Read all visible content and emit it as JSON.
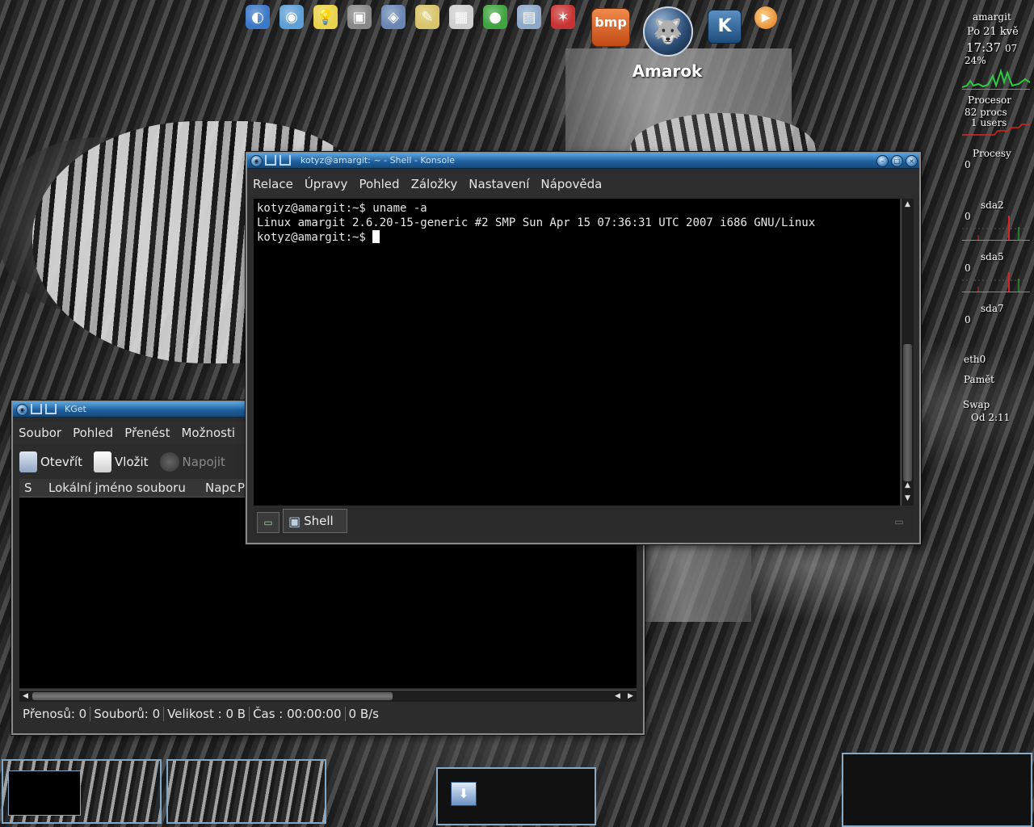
{
  "dock": {
    "launchers": [
      {
        "name": "browser-icon",
        "glyph": "◐",
        "color": "#3a78c8"
      },
      {
        "name": "globe-icon",
        "glyph": "◉",
        "color": "#5d9fd6"
      },
      {
        "name": "lightbulb-icon",
        "glyph": "💡",
        "color": "#e9d34a"
      },
      {
        "name": "monitor-icon",
        "glyph": "▣",
        "color": "#888888"
      },
      {
        "name": "save-disk-icon",
        "glyph": "◈",
        "color": "#6a86b4"
      },
      {
        "name": "notepad-icon",
        "glyph": "✎",
        "color": "#d9c46a"
      },
      {
        "name": "spreadsheet-icon",
        "glyph": "▦",
        "color": "#cfcfcf"
      },
      {
        "name": "network-globe-icon",
        "glyph": "●",
        "color": "#3fa53f"
      },
      {
        "name": "photos-icon",
        "glyph": "▤",
        "color": "#8da8c9"
      },
      {
        "name": "pdf-icon",
        "glyph": "✶",
        "color": "#c93333"
      }
    ],
    "bmp_label": "bmp",
    "active_app_label": "Amarok"
  },
  "sysmon": {
    "host": "amargit",
    "date": "Po 21 kvě",
    "time": "17:37",
    "seconds": "07",
    "cpu_percent": "24%",
    "cpu_label": "Procesor",
    "procs": "82 procs",
    "users": "1 users",
    "processes_label": "Procesy",
    "processes_value": "0",
    "disks": [
      {
        "name": "sda2",
        "value": "0"
      },
      {
        "name": "sda5",
        "value": "0"
      },
      {
        "name": "sda7",
        "value": "0"
      }
    ],
    "net_label": "eth0",
    "mem_label": "Pamět",
    "swap_label": "Swap",
    "uptime": "Od  2:11"
  },
  "konsole": {
    "title": "kotyz@amargit: ~ - Shell - Konsole",
    "menu": [
      "Relace",
      "Úpravy",
      "Pohled",
      "Záložky",
      "Nastavení",
      "Nápověda"
    ],
    "lines": [
      "kotyz@amargit:~$ uname -a",
      "Linux amargit 2.6.20-15-generic #2 SMP Sun Apr 15 07:36:31 UTC 2007 i686 GNU/Linux",
      "kotyz@amargit:~$ "
    ],
    "tab_label": "Shell"
  },
  "kget": {
    "title": "KGet",
    "menu": [
      "Soubor",
      "Pohled",
      "Přenést",
      "Možnosti"
    ],
    "toolbar": {
      "open": "Otevřít",
      "paste": "Vložit",
      "connect": "Napojit"
    },
    "columns": {
      "s": "S",
      "name": "Lokální jméno souboru",
      "col3": "Napc",
      "col4": "P"
    },
    "status": {
      "transfers": "Přenosů: 0",
      "files": "Souborů: 0",
      "size": "Velikost : 0 B",
      "time": "Čas : 00:00:00",
      "speed": "0 B/s"
    }
  }
}
